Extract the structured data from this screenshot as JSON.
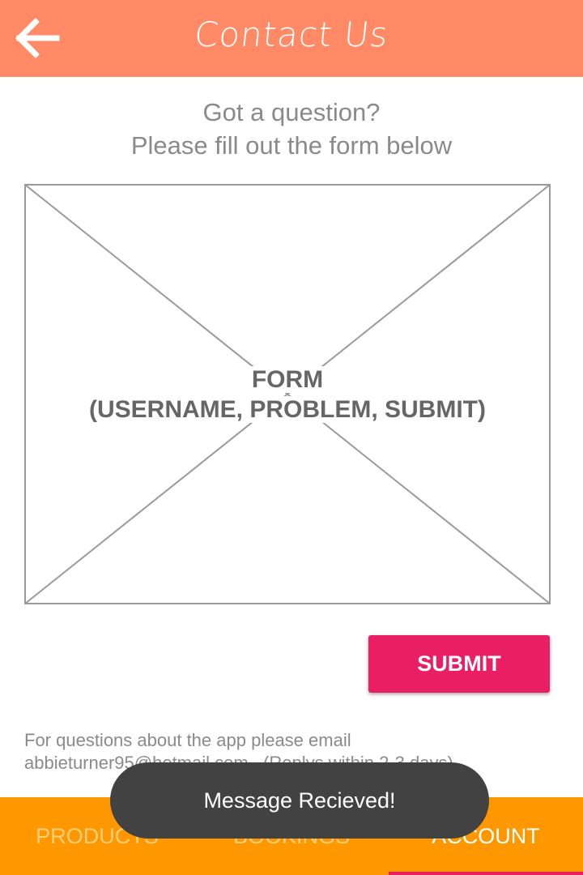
{
  "appbar": {
    "title": "Contact Us",
    "back_icon": "arrow-left-icon",
    "background": "#ff8a65"
  },
  "intro": {
    "line1": "Got a question?",
    "line2": "Please fill out the form below"
  },
  "form_placeholder": {
    "line1": "FORM",
    "line2": "(USERNAME, PROBLEM, SUBMIT)"
  },
  "submit": {
    "label": "SUBMIT",
    "color": "#e91e63"
  },
  "footer_note": {
    "line1": "For questions about the app please email",
    "line2": "abbieturner95@hotmail.com . (Replys within 2-3 days)"
  },
  "bottom_nav": {
    "background": "#ff9800",
    "items": [
      {
        "label": "PRODUCTS",
        "active": false
      },
      {
        "label": "BOOKINGS",
        "active": false
      },
      {
        "label": "ACCOUNT",
        "active": true
      }
    ]
  },
  "toast": {
    "message": "Message Recieved!"
  }
}
